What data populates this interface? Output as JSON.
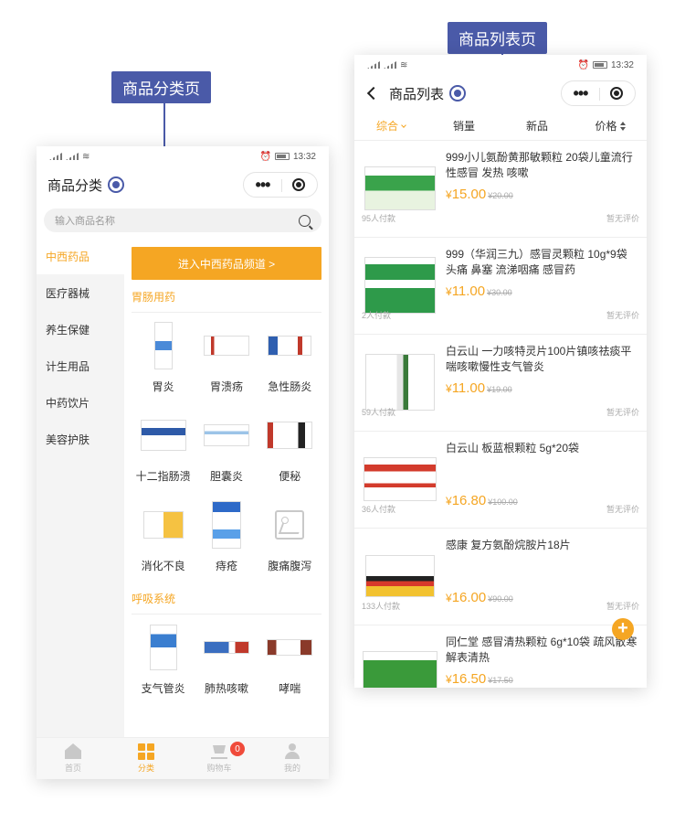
{
  "callouts": {
    "category": "商品分类页",
    "list": "商品列表页"
  },
  "status": {
    "time": "13:32"
  },
  "category_page": {
    "title": "商品分类",
    "search_placeholder": "输入商品名称",
    "sidebar": [
      "中西药品",
      "医疗器械",
      "养生保健",
      "计生用品",
      "中药饮片",
      "美容护肤"
    ],
    "banner": "进入中西药品频道 >",
    "sections": [
      {
        "title": "胃肠用药",
        "items": [
          "胃炎",
          "胃溃疡",
          "急性肠炎",
          "十二指肠溃",
          "胆囊炎",
          "便秘",
          "消化不良",
          "痔疮",
          "腹痛腹泻"
        ]
      },
      {
        "title": "呼吸系统",
        "items": [
          "支气管炎",
          "肺热咳嗽",
          "哮喘"
        ]
      }
    ],
    "tabs": [
      "首页",
      "分类",
      "购物车",
      "我的"
    ],
    "cart_count": "0"
  },
  "list_page": {
    "title": "商品列表",
    "sorts": [
      "综合",
      "销量",
      "新品",
      "价格"
    ],
    "products": [
      {
        "name": "999小儿氨酚黄那敏颗粒 20袋儿童流行性感冒 发热 咳嗽",
        "price": "15.00",
        "old": "¥20.00",
        "sold": "95人付款",
        "review": "暂无评价",
        "color": "#3aa34b"
      },
      {
        "name": "999（华润三九）感冒灵颗粒 10g*9袋 头痛 鼻塞 流涕咽痛 感冒药",
        "price": "11.00",
        "old": "¥30.00",
        "sold": "2人付款",
        "review": "暂无评价",
        "color": "#2e9a4a"
      },
      {
        "name": "白云山 一力咳特灵片100片镇咳祛痰平喘咳嗽慢性支气管炎",
        "price": "11.00",
        "old": "¥19.00",
        "sold": "59人付款",
        "review": "暂无评价",
        "color": "#3a7a3a"
      },
      {
        "name": "白云山 板蓝根颗粒 5g*20袋",
        "price": "16.80",
        "old": "¥100.00",
        "sold": "36人付款",
        "review": "暂无评价",
        "color": "#d33b2c"
      },
      {
        "name": "感康 复方氨酚烷胺片18片",
        "price": "16.00",
        "old": "¥90.00",
        "sold": "133人付款",
        "review": "暂无评价",
        "color": "#d8392b"
      },
      {
        "name": "同仁堂 感冒清热颗粒 6g*10袋 疏风散寒 解表清热",
        "price": "16.50",
        "old": "¥17.50",
        "sold": "",
        "review": "",
        "color": "#3a9a3a"
      }
    ]
  },
  "colors": {
    "accent": "#f5a623",
    "callout": "#4a5aa8",
    "badge": "#f04b3b"
  }
}
